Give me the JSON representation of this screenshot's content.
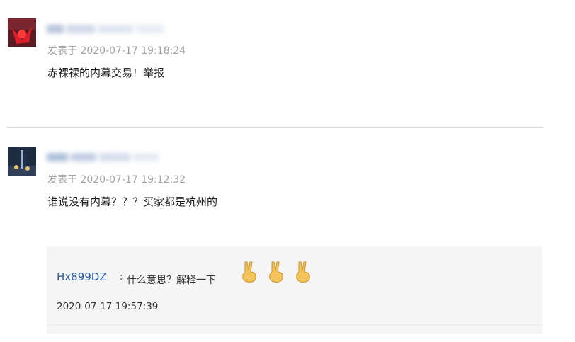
{
  "comments": [
    {
      "avatar_icon": "avatar-icon",
      "posted_label": "发表于",
      "timestamp": "2020-07-17 19:18:24",
      "text": "赤裸裸的内幕交易！举报"
    },
    {
      "avatar_icon": "avatar-icon",
      "posted_label": "发表于",
      "timestamp": "2020-07-17 19:12:32",
      "text": "谁说没有内幕？？？买家都是杭州的",
      "reply": {
        "username": "Hx899DZ",
        "separator": ":",
        "text": "什么意思？解释一下",
        "emojis": [
          "victory-hand-icon",
          "victory-hand-icon",
          "victory-hand-icon"
        ],
        "timestamp": "2020-07-17 19:57:39"
      }
    }
  ],
  "colors": {
    "username_link": "#2a5a9b",
    "meta_gray": "#a3a3a3",
    "reply_bg": "#f5f5f5",
    "divider": "#dcdcdc"
  }
}
